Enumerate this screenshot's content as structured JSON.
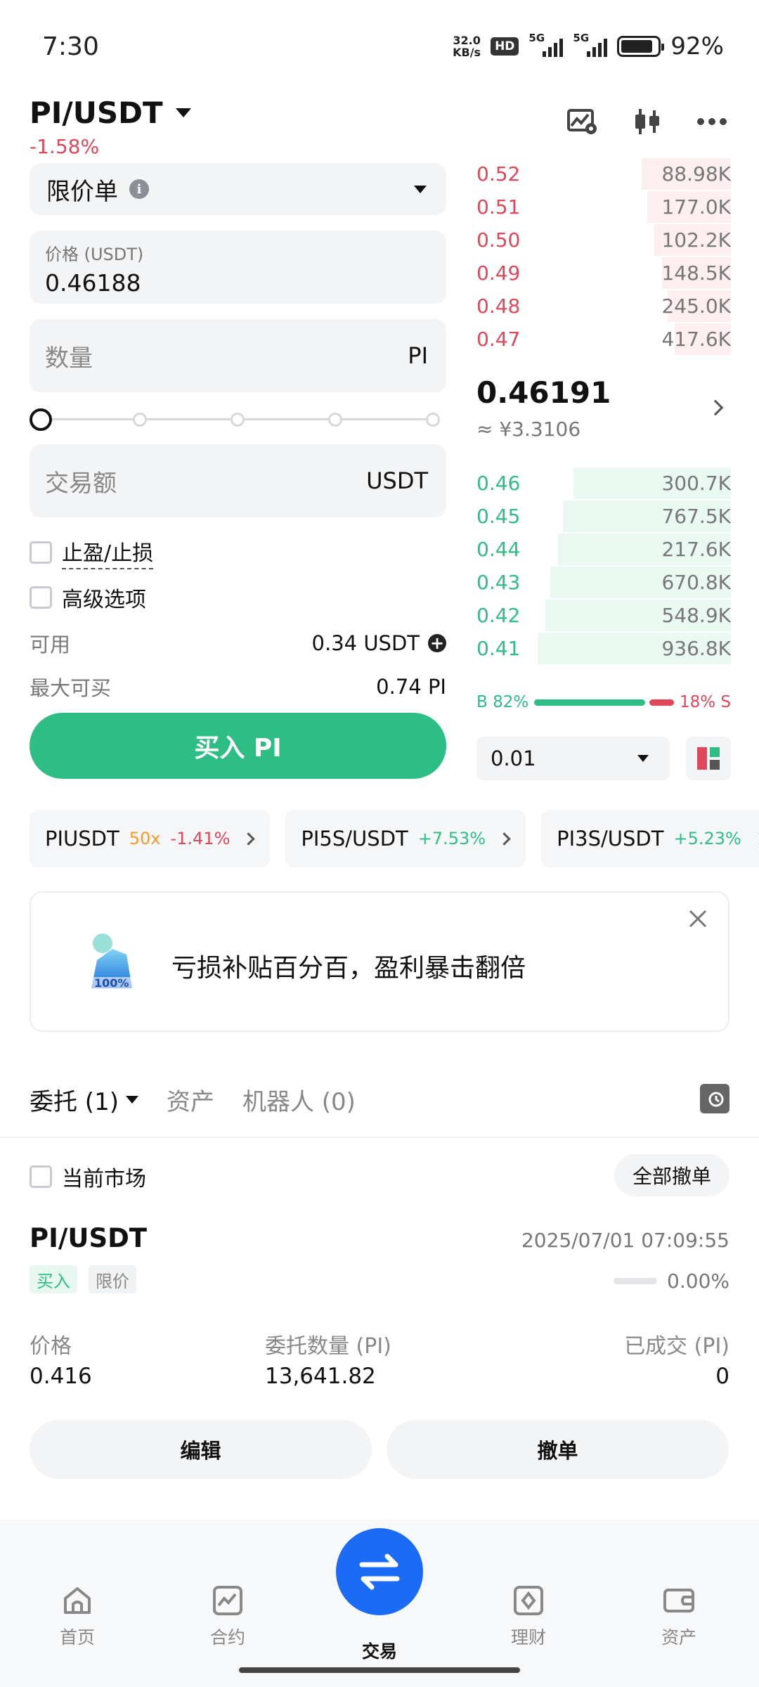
{
  "status_bar": {
    "time": "7:30",
    "net_speed_value": "32.0",
    "net_speed_unit": "KB/s",
    "hd": "HD",
    "signal1": "5G",
    "signal2": "5G",
    "battery": "92%"
  },
  "header": {
    "pair": "PI/USDT",
    "change": "-1.58%"
  },
  "form": {
    "order_type": "限价单",
    "price_label": "价格 (USDT)",
    "price_value": "0.46188",
    "qty_placeholder": "数量",
    "qty_unit": "PI",
    "slider_value": 0,
    "amount_placeholder": "交易额",
    "amount_unit": "USDT",
    "tp_sl": "止盈/止损",
    "advanced": "高级选项",
    "available_label": "可用",
    "available_value": "0.34 USDT",
    "max_buy_label": "最大可买",
    "max_buy_value": "0.74 PI",
    "buy_button": "买入 PI"
  },
  "orderbook": {
    "asks": [
      {
        "price": "0.52",
        "qty": "88.98K",
        "depth": 0.35
      },
      {
        "price": "0.51",
        "qty": "177.0K",
        "depth": 0.33
      },
      {
        "price": "0.50",
        "qty": "102.2K",
        "depth": 0.3
      },
      {
        "price": "0.49",
        "qty": "148.5K",
        "depth": 0.27
      },
      {
        "price": "0.48",
        "qty": "245.0K",
        "depth": 0.25
      },
      {
        "price": "0.47",
        "qty": "417.6K",
        "depth": 0.22
      }
    ],
    "last_price": "0.46191",
    "last_price_cny": "≈ ¥3.3106",
    "bids": [
      {
        "price": "0.46",
        "qty": "300.7K",
        "depth": 0.62
      },
      {
        "price": "0.45",
        "qty": "767.5K",
        "depth": 0.66
      },
      {
        "price": "0.44",
        "qty": "217.6K",
        "depth": 0.68
      },
      {
        "price": "0.43",
        "qty": "670.8K",
        "depth": 0.71
      },
      {
        "price": "0.42",
        "qty": "548.9K",
        "depth": 0.73
      },
      {
        "price": "0.41",
        "qty": "936.8K",
        "depth": 0.76
      }
    ],
    "buy_ratio_label": "B 82%",
    "sell_ratio_label": "18% S",
    "buy_ratio": 82,
    "depth_step": "0.01"
  },
  "related_pairs": [
    {
      "name": "PIUSDT",
      "leverage": "50x",
      "change": "-1.41%",
      "dir": "neg"
    },
    {
      "name": "PI5S/USDT",
      "leverage": "",
      "change": "+7.53%",
      "dir": "pos"
    },
    {
      "name": "PI3S/USDT",
      "leverage": "",
      "change": "+5.23%",
      "dir": "pos"
    }
  ],
  "banner": {
    "text": "亏损补贴百分百，盈利暴击翻倍",
    "image_text": "100%"
  },
  "tabs": {
    "orders": "委托 (1)",
    "assets": "资产",
    "bots": "机器人 (0)"
  },
  "orders": {
    "current_market": "当前市场",
    "cancel_all": "全部撤单",
    "items": [
      {
        "pair": "PI/USDT",
        "time": "2025/07/01 07:09:55",
        "side": "买入",
        "type": "限价",
        "filled_pct": "0.00%",
        "price_label": "价格",
        "price": "0.416",
        "amount_label": "委托数量 (PI)",
        "amount": "13,641.82",
        "filled_label": "已成交 (PI)",
        "filled": "0",
        "edit": "编辑",
        "cancel": "撤单"
      }
    ]
  },
  "nav": {
    "home": "首页",
    "futures": "合约",
    "trade": "交易",
    "earn": "理财",
    "assets": "资产"
  },
  "colors": {
    "buy_green": "#2ebd85",
    "sell_red": "#e0475a",
    "trade_blue": "#1b6bf5"
  }
}
